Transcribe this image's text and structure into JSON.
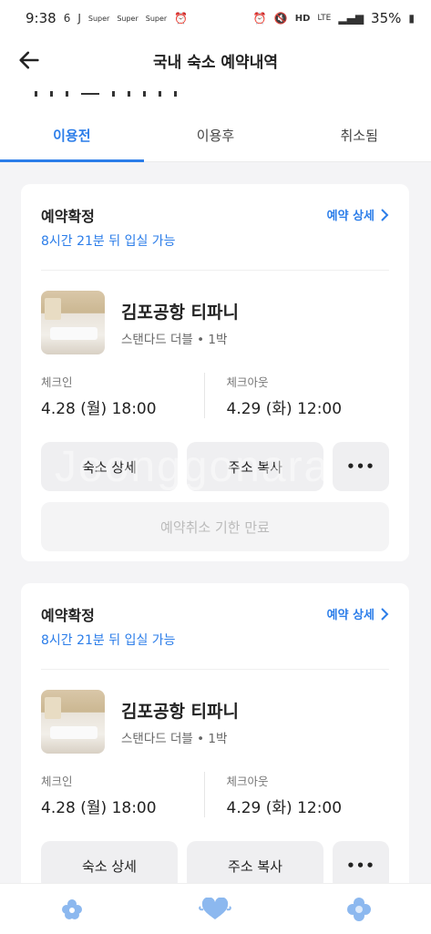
{
  "status_bar": {
    "time": "9:38",
    "left_icons": [
      "6",
      "J",
      "Super",
      "Super",
      "Super",
      "alarm-icon"
    ],
    "right_icons": [
      "alarm-icon",
      "mute-icon",
      "HD",
      "LTE",
      "signal-icon"
    ],
    "battery": "35%"
  },
  "header": {
    "title": "국내 숙소 예약내역"
  },
  "tabs": [
    {
      "label": "이용전",
      "active": true
    },
    {
      "label": "이용후",
      "active": false
    },
    {
      "label": "취소됨",
      "active": false
    }
  ],
  "reservations": [
    {
      "status": "예약확정",
      "detail_link": "예약 상세",
      "checkin_note": "8시간 21분 뒤 입실 가능",
      "hotel_name": "김포공항 티파니",
      "room_info": "스탠다드 더블 • 1박",
      "checkin_label": "체크인",
      "checkin_value": "4.28 (월) 18:00",
      "checkout_label": "체크아웃",
      "checkout_value": "4.29 (화) 12:00",
      "btn_detail": "숙소 상세",
      "btn_copy": "주소 복사",
      "btn_more": "•••",
      "btn_cancel": "예약취소 기한 만료"
    },
    {
      "status": "예약확정",
      "detail_link": "예약 상세",
      "checkin_note": "8시간 21분 뒤 입실 가능",
      "hotel_name": "김포공항 티파니",
      "room_info": "스탠다드 더블 • 1박",
      "checkin_label": "체크인",
      "checkin_value": "4.28 (월) 18:00",
      "checkout_label": "체크아웃",
      "checkout_value": "4.29 (화) 12:00",
      "btn_detail": "숙소 상세",
      "btn_copy": "주소 복사",
      "btn_more": "•••"
    }
  ],
  "watermark": "Joonggonara",
  "colors": {
    "accent": "#2b7de9",
    "bottom_icon": "#8cb8ef"
  },
  "bottom_nav": [
    "flower-icon",
    "heart-icon",
    "flower-alt-icon"
  ]
}
